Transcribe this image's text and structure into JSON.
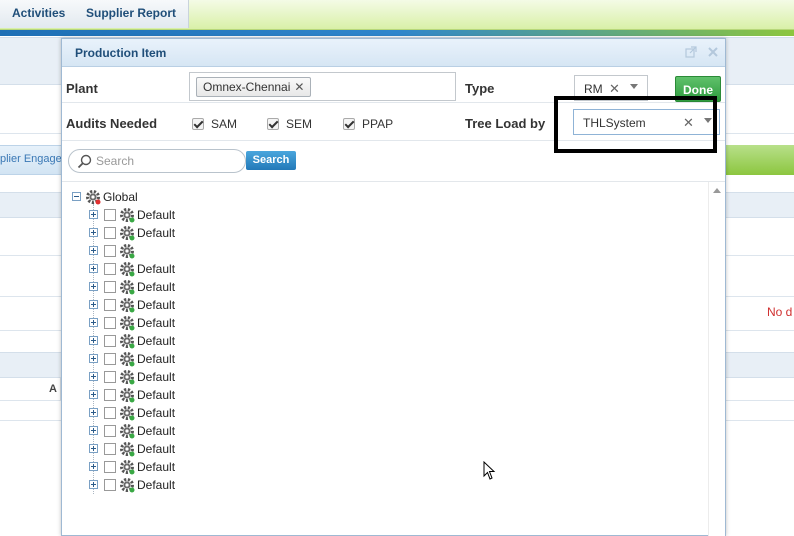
{
  "top_tabs": [
    {
      "label": "Activities"
    },
    {
      "label": "Supplier Report"
    }
  ],
  "background": {
    "engage_label": "plier Engage",
    "no_data_text": "No d",
    "column_label": "A"
  },
  "dialog": {
    "title": "Production Item",
    "plant": {
      "label": "Plant",
      "value": "Omnex-Chennai"
    },
    "type": {
      "label": "Type",
      "value": "RM"
    },
    "done_label": "Done",
    "audits": {
      "label": "Audits Needed",
      "options": [
        {
          "label": "SAM",
          "checked": true
        },
        {
          "label": "SEM",
          "checked": true
        },
        {
          "label": "PPAP",
          "checked": true
        }
      ]
    },
    "tree_load": {
      "label": "Tree Load by",
      "value": "THLSystem"
    },
    "search": {
      "placeholder": "Search",
      "button_label": "Search"
    },
    "tree": {
      "root": "Global",
      "nodes": [
        {
          "label": "Default"
        },
        {
          "label": "Default"
        },
        {
          "label": ""
        },
        {
          "label": "Default"
        },
        {
          "label": "Default"
        },
        {
          "label": "Default"
        },
        {
          "label": "Default"
        },
        {
          "label": "Default"
        },
        {
          "label": "Default"
        },
        {
          "label": "Default"
        },
        {
          "label": "Default"
        },
        {
          "label": "Default"
        },
        {
          "label": "Default"
        },
        {
          "label": "Default"
        },
        {
          "label": "Default"
        },
        {
          "label": "Default"
        }
      ]
    }
  },
  "colors": {
    "accent": "#1f4e79",
    "done": "#2e9b3e",
    "search_btn": "#2379b8",
    "error": "#d03030"
  }
}
